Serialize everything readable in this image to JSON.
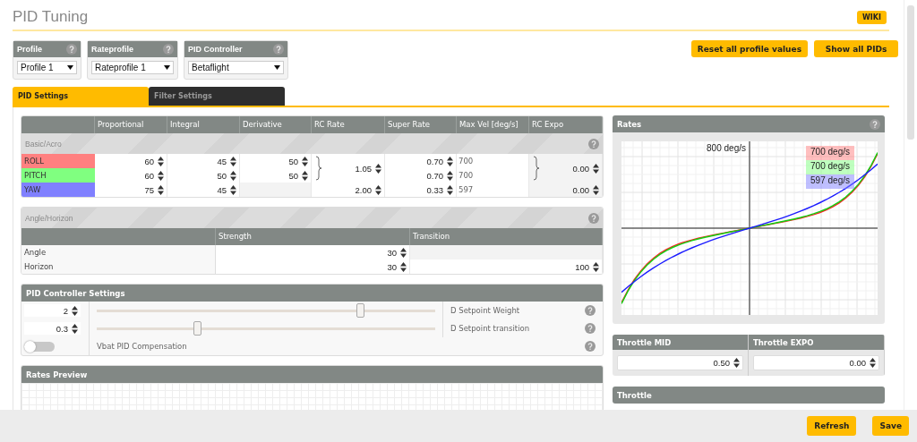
{
  "page": {
    "title": "PID Tuning",
    "wiki": "WIKI"
  },
  "selectors": [
    {
      "label": "Profile",
      "value": "Profile 1"
    },
    {
      "label": "Rateprofile",
      "value": "Rateprofile 1"
    },
    {
      "label": "PID Controller",
      "value": "Betaflight"
    }
  ],
  "actions": [
    "Reset all profile values",
    "Show all PIDs"
  ],
  "tabs": [
    {
      "label": "PID Settings",
      "selected": true
    },
    {
      "label": "Filter Settings",
      "selected": false
    }
  ],
  "pid_table": {
    "columns": [
      "Proportional",
      "Integral",
      "Derivative",
      "RC Rate",
      "Super Rate",
      "Max Vel [deg/s]",
      "RC Expo"
    ],
    "section": "Basic/Acro",
    "rows": [
      {
        "name": "ROLL",
        "color": "#ff8080",
        "p": "60",
        "i": "45",
        "d": "50",
        "super_rate": "0.70",
        "max_vel": "700"
      },
      {
        "name": "PITCH",
        "color": "#80ff80",
        "p": "60",
        "i": "50",
        "d": "50",
        "super_rate": "0.70",
        "max_vel": "700"
      },
      {
        "name": "YAW",
        "color": "#8080ff",
        "p": "75",
        "i": "45",
        "super_rate": "0.33",
        "max_vel": "597"
      }
    ],
    "rc_rate": {
      "roll_pitch": "1.05",
      "yaw": "2.00"
    },
    "rc_expo": {
      "roll_pitch": "0.00",
      "yaw": "0.00"
    }
  },
  "angle_horizon": {
    "title": "Angle/Horizon",
    "columns": [
      "Strength",
      "Transition"
    ],
    "rows": [
      {
        "name": "Angle",
        "strength": "30"
      },
      {
        "name": "Horizon",
        "strength": "30",
        "transition": "100"
      }
    ]
  },
  "controller_settings": {
    "title": "PID Controller Settings",
    "items": [
      {
        "kind": "slider",
        "value": "2",
        "level": 0.78,
        "label": "D Setpoint Weight"
      },
      {
        "kind": "slider",
        "value": "0.3",
        "level": 0.3,
        "label": "D Setpoint transition"
      },
      {
        "kind": "toggle",
        "on": false,
        "label": "Vbat PID Compensation"
      }
    ]
  },
  "rates_preview": {
    "title": "Rates Preview"
  },
  "rates": {
    "title": "Rates",
    "max_label": "800 deg/s",
    "curve_labels": [
      "700 deg/s",
      "700 deg/s",
      "597 deg/s"
    ]
  },
  "throttle": {
    "columns": [
      {
        "label": "Throttle MID",
        "value": "0.50"
      },
      {
        "label": "Throttle EXPO",
        "value": "0.00"
      }
    ],
    "title": "Throttle"
  },
  "footer": [
    "Refresh",
    "Save"
  ]
}
